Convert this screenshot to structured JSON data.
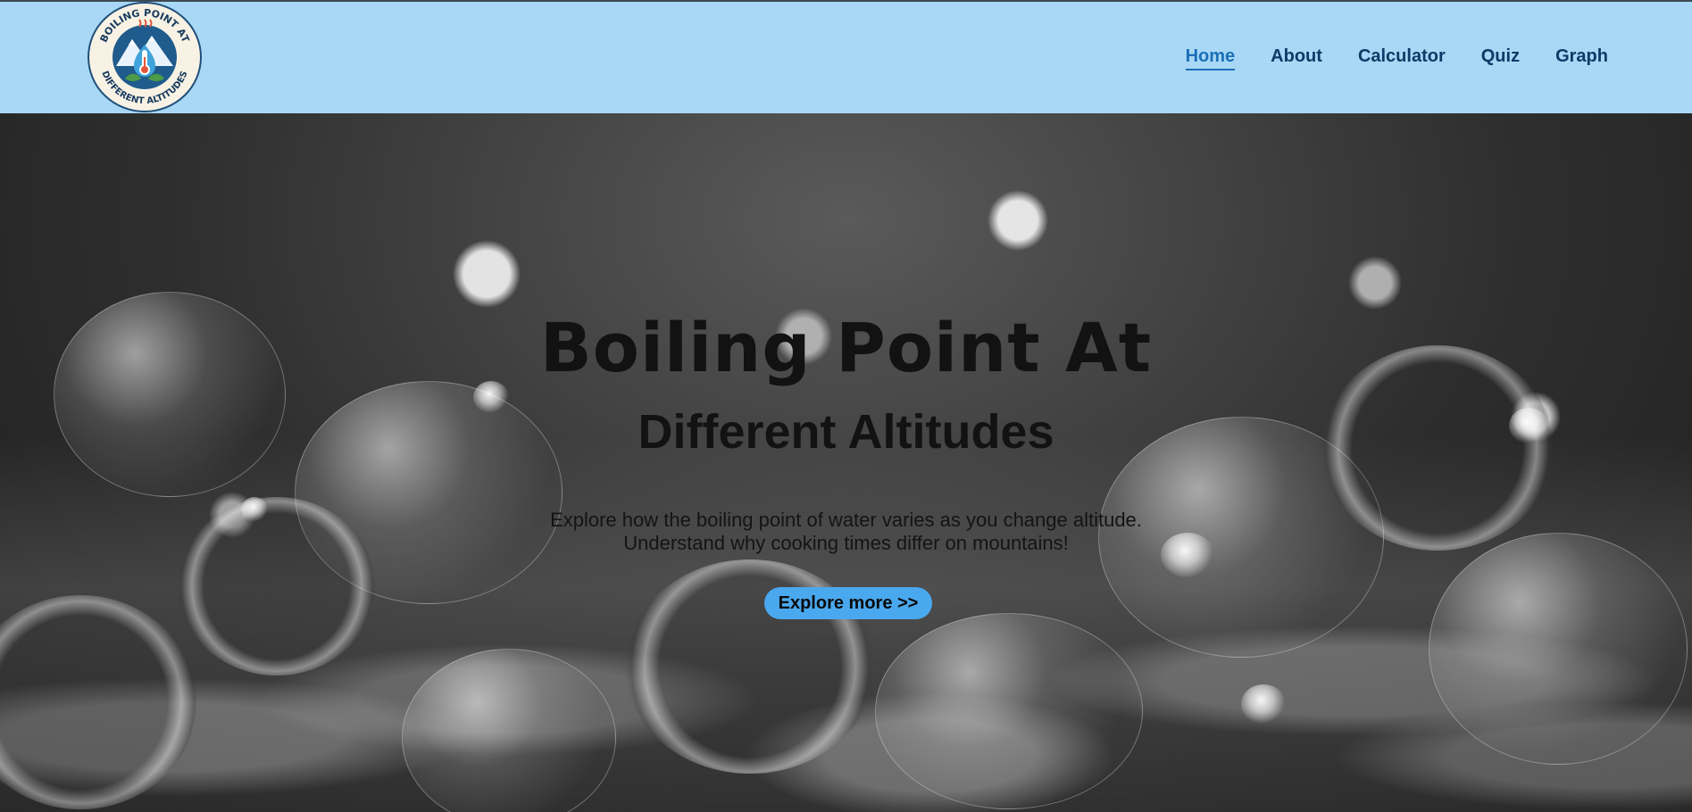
{
  "header": {
    "logo": {
      "top_text": "BOILING POINT AT",
      "bottom_text": "DIFFERENT ALTITUDES",
      "icon": "thermometer-mountain-logo-icon"
    },
    "nav": [
      {
        "label": "Home",
        "active": true
      },
      {
        "label": "About",
        "active": false
      },
      {
        "label": "Calculator",
        "active": false
      },
      {
        "label": "Quiz",
        "active": false
      },
      {
        "label": "Graph",
        "active": false
      }
    ]
  },
  "hero": {
    "title": "Boiling Point At",
    "subtitle": "Different Altitudes",
    "description_line1": "Explore how the boiling point of water varies as you change altitude.",
    "description_line2": "Understand why cooking times differ on mountains!",
    "cta_label": "Explore more >>",
    "background": "boiling-water-bubbles-image"
  },
  "colors": {
    "header_bg": "#a8d8f5",
    "nav_text": "#0d3a66",
    "nav_active": "#1b6fb8",
    "cta_bg": "#4aa8ee"
  }
}
